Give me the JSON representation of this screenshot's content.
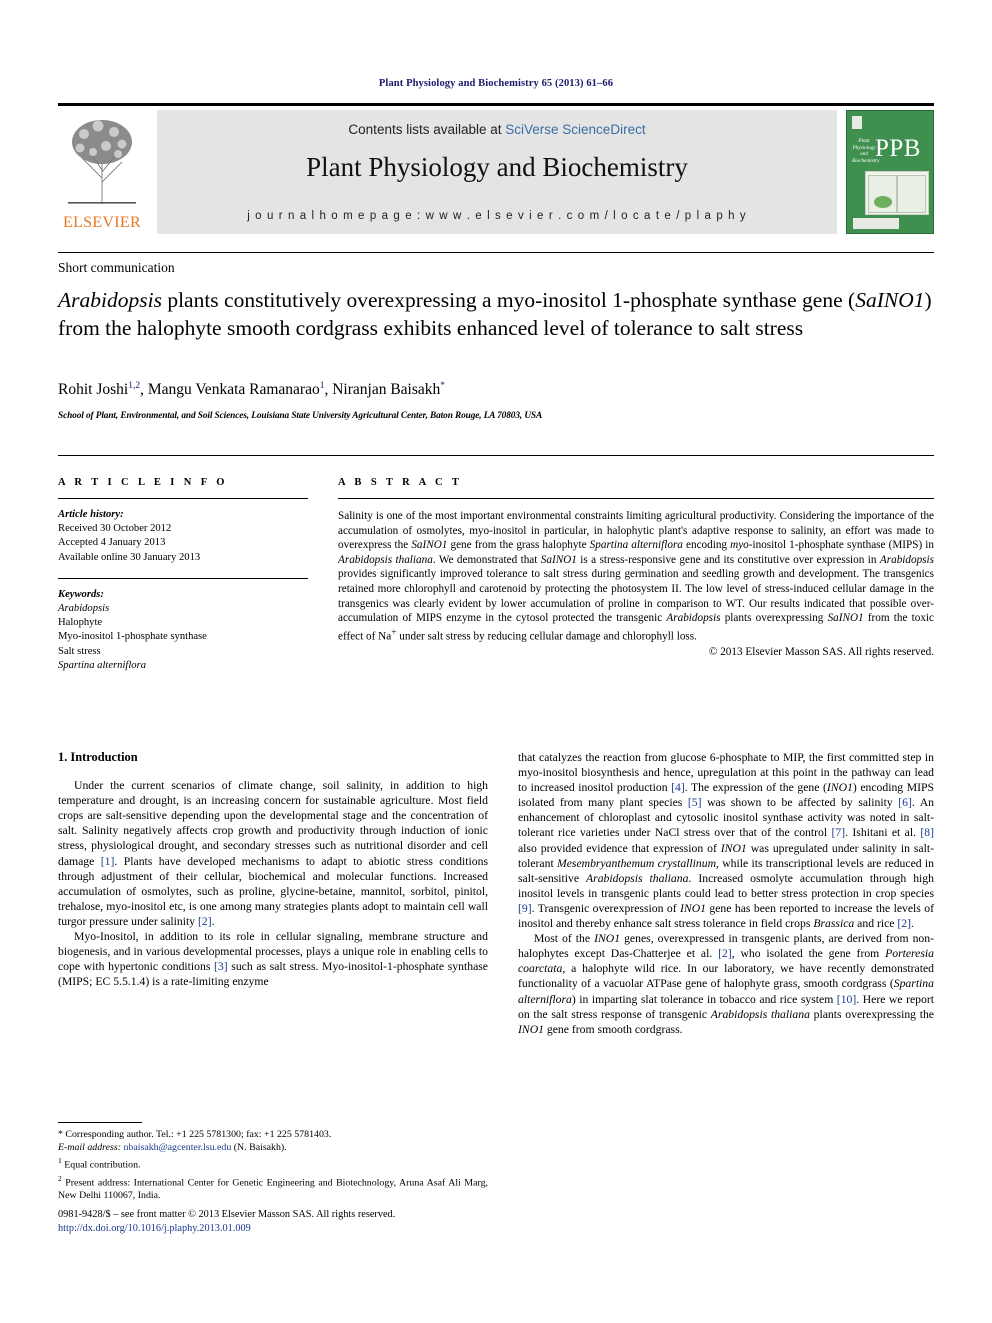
{
  "running_head": "Plant Physiology and Biochemistry 65 (2013) 61–66",
  "masthead": {
    "contents_prefix": "Contents lists available at ",
    "contents_link": "SciVerse ScienceDirect",
    "journal_title": "Plant Physiology and Biochemistry",
    "homepage": "j o u r n a l   h o m e p a g e :   w w w . e l s e v i e r . c o m / l o c a t e / p l a p h y",
    "publisher_name": "ELSEVIER",
    "cover_badge": "PPB",
    "cover_sub": "Plant Physiology and Biochemistry"
  },
  "article": {
    "type": "Short communication",
    "title_part1": "Arabidopsis",
    "title_part2": " plants constitutively overexpressing a myo-inositol 1-phosphate synthase gene (",
    "title_gene": "SaINO1",
    "title_part3": ") from the halophyte smooth cordgrass exhibits enhanced level of tolerance to salt stress",
    "authors_plain": "Rohit Joshi 1,2, Mangu Venkata Ramanarao 1, Niranjan Baisakh*",
    "author1": "Rohit Joshi",
    "author1_sup": "1,2",
    "author2": "Mangu Venkata Ramanarao",
    "author2_sup": "1",
    "author3": "Niranjan Baisakh",
    "author3_sup": "*",
    "affiliation": "School of Plant, Environmental, and Soil Sciences, Louisiana State University Agricultural Center, Baton Rouge, LA 70803, USA"
  },
  "info": {
    "label": "A R T I C L E   I N F O",
    "history_header": "Article history:",
    "history": [
      "Received 30 October 2012",
      "Accepted 4 January 2013",
      "Available online 30 January 2013"
    ],
    "keywords_header": "Keywords:",
    "keywords": [
      "Arabidopsis",
      "Halophyte",
      "Myo-inositol 1-phosphate synthase",
      "Salt stress",
      "Spartina alterniflora"
    ],
    "keywords_italic": [
      true,
      false,
      false,
      false,
      true
    ]
  },
  "abstract": {
    "label": "A B S T R A C T",
    "text_runs": [
      {
        "t": "Salinity is one of the most important environmental constraints limiting agricultural productivity. Considering the importance of the accumulation of osmolytes, myo-inositol in particular, in halophytic plant's adaptive response to salinity, an effort was made to overexpress the ",
        "i": false
      },
      {
        "t": "SaINO1",
        "i": true
      },
      {
        "t": " gene from the grass halophyte ",
        "i": false
      },
      {
        "t": "Spartina alterniflora",
        "i": true
      },
      {
        "t": " encoding ",
        "i": false
      },
      {
        "t": "myo",
        "i": true
      },
      {
        "t": "-inositol 1-phosphate synthase (MIPS) in ",
        "i": false
      },
      {
        "t": "Arabidopsis thaliana",
        "i": true
      },
      {
        "t": ". We demonstrated that ",
        "i": false
      },
      {
        "t": "SaINO1",
        "i": true
      },
      {
        "t": " is a stress-responsive gene and its constitutive over expression in ",
        "i": false
      },
      {
        "t": "Arabidopsis",
        "i": true
      },
      {
        "t": " provides significantly improved tolerance to salt stress during germination and seedling growth and development. The transgenics retained more chlorophyll and carotenoid by protecting the photosystem II. The low level of stress-induced cellular damage in the transgenics was clearly evident by lower accumulation of proline in comparison to WT. Our results indicated that possible over-accumulation of MIPS enzyme in the cytosol protected the transgenic ",
        "i": false
      },
      {
        "t": "Arabidopsis",
        "i": true
      },
      {
        "t": " plants overexpressing ",
        "i": false
      },
      {
        "t": "SaINO1",
        "i": true
      },
      {
        "t": " from the toxic effect of Na",
        "i": false
      },
      {
        "t": "+",
        "i": false,
        "sup": true
      },
      {
        "t": " under salt stress by reducing cellular damage and chlorophyll loss.",
        "i": false
      }
    ],
    "copyright": "© 2013 Elsevier Masson SAS. All rights reserved."
  },
  "body": {
    "section_heading": "1. Introduction",
    "left_paragraphs": [
      [
        {
          "t": "Under the current scenarios of climate change, soil salinity, in addition to high temperature and drought, is an increasing concern for sustainable agriculture. Most field crops are salt-sensitive depending upon the developmental stage and the concentration of salt. Salinity negatively affects crop growth and productivity through induction of ionic stress, physiological drought, and secondary stresses such as nutritional disorder and cell damage "
        },
        {
          "t": "[1]",
          "ref": true
        },
        {
          "t": ". Plants have developed mechanisms to adapt to abiotic stress conditions through adjustment of their cellular, biochemical and molecular functions. Increased accumulation of osmolytes, such as proline, glycine-betaine, mannitol, sorbitol, pinitol, trehalose, myo-inositol etc, is one among many strategies plants adopt to maintain cell wall turgor pressure under salinity "
        },
        {
          "t": "[2]",
          "ref": true
        },
        {
          "t": "."
        }
      ],
      [
        {
          "t": "Myo-Inositol, in addition to its role in cellular signaling, membrane structure and biogenesis, and in various developmental processes, plays a unique role in enabling cells to cope with hypertonic conditions "
        },
        {
          "t": "[3]",
          "ref": true
        },
        {
          "t": " such as salt stress. Myo-inositol-1-phosphate synthase (MIPS; EC 5.5.1.4) is a rate-limiting enzyme"
        }
      ]
    ],
    "right_paragraphs": [
      [
        {
          "t": "that catalyzes the reaction from glucose 6-phosphate to MIP, the first committed step in myo-inositol biosynthesis and hence, upregulation at this point in the pathway can lead to increased inositol production "
        },
        {
          "t": "[4]",
          "ref": true
        },
        {
          "t": ". The expression of the gene ("
        },
        {
          "t": "INO1",
          "i": true
        },
        {
          "t": ") encoding MIPS isolated from many plant species "
        },
        {
          "t": "[5]",
          "ref": true
        },
        {
          "t": " was shown to be affected by salinity "
        },
        {
          "t": "[6]",
          "ref": true
        },
        {
          "t": ". An enhancement of chloroplast and cytosolic inositol synthase activity was noted in salt-tolerant rice varieties under NaCl stress over that of the control "
        },
        {
          "t": "[7]",
          "ref": true
        },
        {
          "t": ". Ishitani et al. "
        },
        {
          "t": "[8]",
          "ref": true
        },
        {
          "t": " also provided evidence that expression of "
        },
        {
          "t": "INO1",
          "i": true
        },
        {
          "t": " was upregulated under salinity in salt-tolerant "
        },
        {
          "t": "Mesembryanthemum crystallinum",
          "i": true
        },
        {
          "t": ", while its transcriptional levels are reduced in salt-sensitive "
        },
        {
          "t": "Arabidopsis thaliana",
          "i": true
        },
        {
          "t": ". Increased osmolyte accumulation through high inositol levels in transgenic plants could lead to better stress protection in crop species "
        },
        {
          "t": "[9]",
          "ref": true
        },
        {
          "t": ". Transgenic overexpression of "
        },
        {
          "t": "INO1",
          "i": true
        },
        {
          "t": " gene has been reported to increase the levels of inositol and thereby enhance salt stress tolerance in field crops "
        },
        {
          "t": "Brassica",
          "i": true
        },
        {
          "t": " and rice "
        },
        {
          "t": "[2]",
          "ref": true
        },
        {
          "t": "."
        }
      ],
      [
        {
          "t": "Most of the "
        },
        {
          "t": "INO1",
          "i": true
        },
        {
          "t": " genes, overexpressed in transgenic plants, are derived from non-halophytes except Das-Chatterjee et al. "
        },
        {
          "t": "[2]",
          "ref": true
        },
        {
          "t": ", who isolated the gene from "
        },
        {
          "t": "Porteresia coarctata",
          "i": true
        },
        {
          "t": ", a halophyte wild rice. In our laboratory, we have recently demonstrated functionality of a vacuolar ATPase gene of halophyte grass, smooth cordgrass ("
        },
        {
          "t": "Spartina alterniflora",
          "i": true
        },
        {
          "t": ") in imparting slat tolerance in tobacco and rice system "
        },
        {
          "t": "[10]",
          "ref": true
        },
        {
          "t": ". Here we report on the salt stress response of transgenic "
        },
        {
          "t": "Arabidopsis thaliana",
          "i": true
        },
        {
          "t": " plants overexpressing the "
        },
        {
          "t": "INO1",
          "i": true
        },
        {
          "t": " gene from smooth cordgrass."
        }
      ]
    ]
  },
  "footnotes": {
    "corresponding": "* Corresponding author. Tel.: +1 225 5781300; fax: +1 225 5781403.",
    "email_label": "E-mail address:",
    "email": "nbaisakh@agcenter.lsu.edu",
    "email_suffix": "(N. Baisakh).",
    "note1_sup": "1",
    "note1": "Equal contribution.",
    "note2_sup": "2",
    "note2": "Present address: International Center for Genetic Engineering and Biotechnology, Aruna Asaf Ali Marg, New Delhi 110067, India."
  },
  "imprint": {
    "line1": "0981-9428/$ – see front matter © 2013 Elsevier Masson SAS. All rights reserved.",
    "doi": "http://dx.doi.org/10.1016/j.plaphy.2013.01.009"
  },
  "colors": {
    "running_head": "#1a1a6e",
    "link": "#3a6ea5",
    "reference": "#1a3a8f",
    "elsevier_orange": "#E87722",
    "band_gray": "#e4e4e4",
    "ppb_green": "#3f8f4f"
  }
}
